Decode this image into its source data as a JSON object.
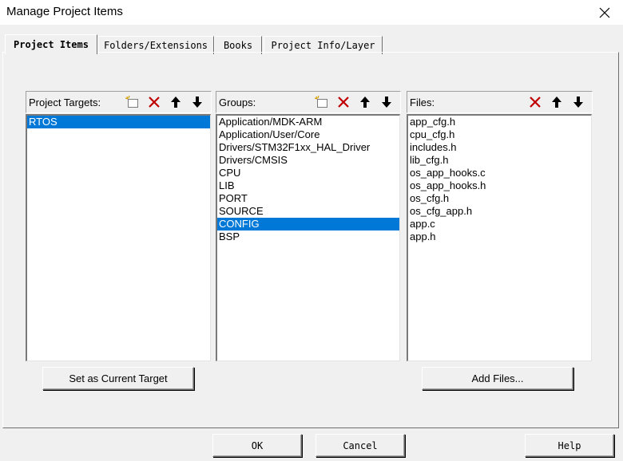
{
  "window": {
    "title": "Manage Project Items"
  },
  "tabs": [
    {
      "label": "Project Items"
    },
    {
      "label": "Folders/Extensions"
    },
    {
      "label": "Books"
    },
    {
      "label": "Project Info/Layer"
    }
  ],
  "targets": {
    "label": "Project Targets:",
    "items": [
      "RTOS"
    ],
    "selected": "RTOS",
    "set_current_label": "Set as Current Target"
  },
  "groups": {
    "label": "Groups:",
    "items": [
      "Application/MDK-ARM",
      "Application/User/Core",
      "Drivers/STM32F1xx_HAL_Driver",
      "Drivers/CMSIS",
      "CPU",
      "LIB",
      "PORT",
      "SOURCE",
      "CONFIG",
      "BSP"
    ],
    "selected": "CONFIG"
  },
  "files": {
    "label": "Files:",
    "items": [
      "app_cfg.h",
      "cpu_cfg.h",
      "includes.h",
      "lib_cfg.h",
      "os_app_hooks.c",
      "os_app_hooks.h",
      "os_cfg.h",
      "os_cfg_app.h",
      "app.c",
      "app.h"
    ],
    "add_files_label": "Add Files..."
  },
  "footer": {
    "ok_label": "OK",
    "cancel_label": "Cancel",
    "help_label": "Help"
  },
  "colors": {
    "selection": "#0078d7",
    "delete_icon": "#c00000"
  },
  "icons": {
    "new": "new-item-icon",
    "delete": "delete-icon",
    "up": "move-up-icon",
    "down": "move-down-icon",
    "close": "close-icon"
  }
}
